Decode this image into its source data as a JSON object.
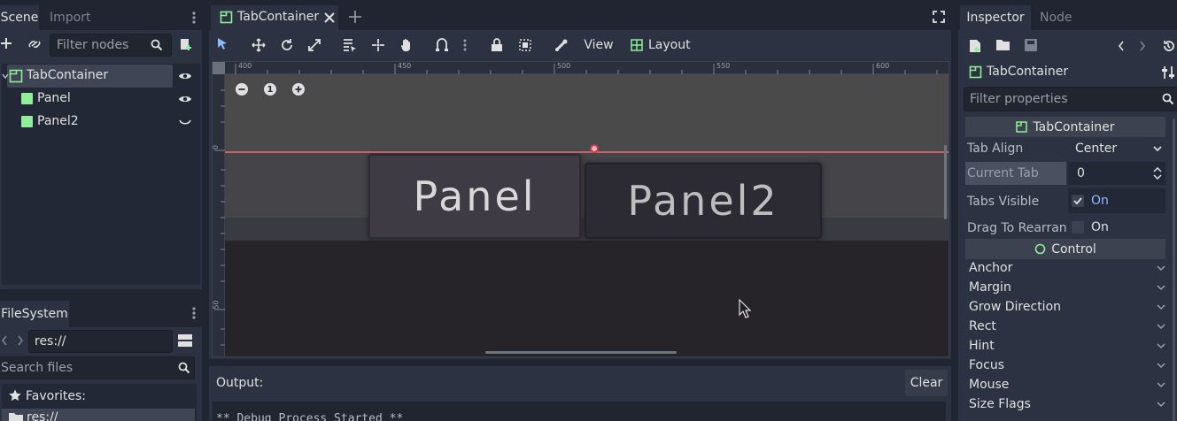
{
  "scene_dock": {
    "tabs": [
      "Scene",
      "Import"
    ],
    "filter_placeholder": "Filter nodes",
    "tree": [
      {
        "label": "TabContainer"
      },
      {
        "label": "Panel"
      },
      {
        "label": "Panel2"
      }
    ]
  },
  "filesystem_dock": {
    "tab": "FileSystem",
    "path": "res://",
    "search_placeholder": "Search files",
    "favorites_label": "Favorites:",
    "res_item": "res://"
  },
  "editor": {
    "tab_title": "TabContainer",
    "toolbar": {
      "view_label": "View",
      "layout_label": "Layout"
    },
    "ruler_labels": [
      "400",
      "450",
      "500",
      "550",
      "600"
    ],
    "ruler_v_labels": [
      "0",
      "50"
    ],
    "zoom_reset_label": "1",
    "viewport_tabs": [
      "Panel",
      "Panel2"
    ]
  },
  "output": {
    "label": "Output:",
    "clear_label": "Clear",
    "log_line": "** Debug Process Started **"
  },
  "inspector": {
    "tabs": [
      "Inspector",
      "Node"
    ],
    "node_name": "TabContainer",
    "filter_placeholder": "Filter properties",
    "section_tabcontainer": "TabContainer",
    "props": {
      "tab_align_label": "Tab Align",
      "tab_align_value": "Center",
      "current_tab_label": "Current Tab",
      "current_tab_value": "0",
      "tabs_visible_label": "Tabs Visible",
      "tabs_visible_value": "On",
      "drag_label": "Drag To Rearran",
      "drag_value": "On"
    },
    "section_control": "Control",
    "categories": [
      "Anchor",
      "Margin",
      "Grow Direction",
      "Rect",
      "Hint",
      "Focus",
      "Mouse",
      "Size Flags"
    ]
  },
  "colors": {
    "accent": "#8eb8ff",
    "node_green": "#8eef97",
    "guide_line": "#e26b78"
  }
}
